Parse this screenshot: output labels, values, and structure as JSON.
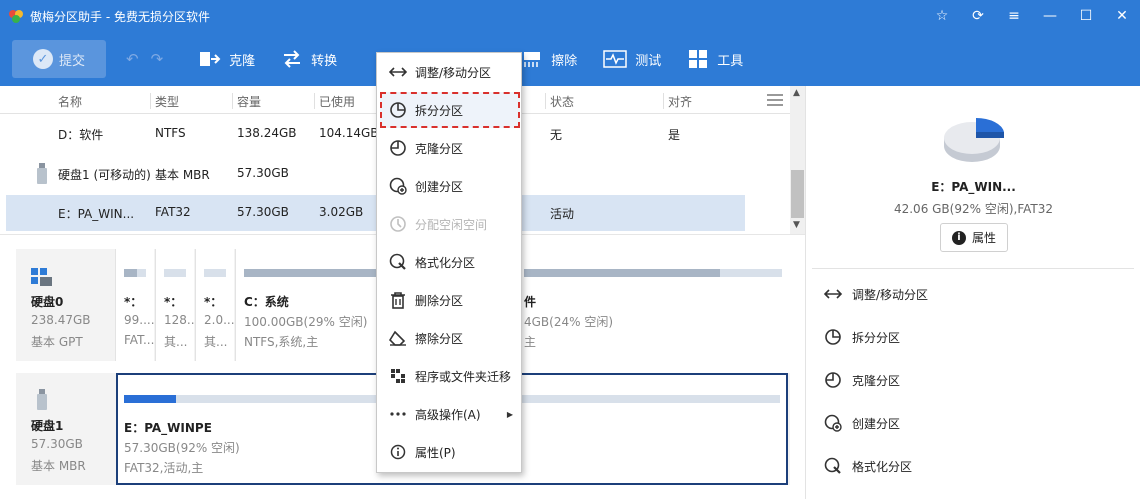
{
  "window": {
    "title": "傲梅分区助手 - 免费无损分区软件",
    "controls": [
      "star-icon",
      "refresh-icon",
      "menu-icon",
      "minimize-icon",
      "maximize-icon",
      "close-icon"
    ]
  },
  "toolbar": {
    "commit_label": "提交",
    "items": [
      {
        "label": "克隆",
        "icon": "clone-icon"
      },
      {
        "label": "转换",
        "icon": "convert-icon"
      },
      {
        "label": "擦除",
        "icon": "wipe-icon"
      },
      {
        "label": "测试",
        "icon": "test-icon"
      },
      {
        "label": "工具",
        "icon": "tools-icon"
      }
    ]
  },
  "table": {
    "headers": [
      "名称",
      "类型",
      "容量",
      "已使用",
      "",
      "状态",
      "对齐"
    ],
    "rows": [
      {
        "name": "D：软件",
        "type": "NTFS",
        "capacity": "138.24GB",
        "used": "104.14GB",
        "status": "无",
        "align": "是"
      },
      {
        "name": "硬盘1 (可移动的)",
        "type": "基本 MBR",
        "capacity": "57.30GB",
        "used": "",
        "status": "",
        "align": ""
      },
      {
        "name": "E：PA_WIN...",
        "type": "FAT32",
        "capacity": "57.30GB",
        "used": "3.02GB",
        "status": "活动",
        "align": ""
      }
    ]
  },
  "disks": [
    {
      "name": "硬盘0",
      "size": "238.47GB",
      "style": "基本 GPT",
      "partitions": [
        {
          "title": "*：",
          "line1": "99....",
          "line2": "FAT...",
          "fill_pct": 60
        },
        {
          "title": "*：",
          "line1": "128...",
          "line2": "其...",
          "fill_pct": 0
        },
        {
          "title": "*：",
          "line1": "2.0...",
          "line2": "其...",
          "fill_pct": 0
        },
        {
          "title": "C：系统",
          "line1": "100.00GB(29% 空闲)",
          "line2": "NTFS,系统,主",
          "fill_pct": 71
        },
        {
          "title": "件",
          "line1": "4GB(24% 空闲)",
          "line2": "主",
          "fill_pct": 76
        }
      ]
    },
    {
      "name": "硬盘1",
      "size": "57.30GB",
      "style": "基本 MBR",
      "partitions": [
        {
          "title": "E：PA_WINPE",
          "line1": "57.30GB(92% 空闲)",
          "line2": "FAT32,活动,主",
          "fill_pct": 8
        }
      ]
    }
  ],
  "context_menu": {
    "items": [
      {
        "label": "调整/移动分区",
        "icon": "resize-icon",
        "enabled": true
      },
      {
        "label": "拆分分区",
        "icon": "split-icon",
        "enabled": true,
        "highlighted": true
      },
      {
        "label": "克隆分区",
        "icon": "clone-partition-icon",
        "enabled": true
      },
      {
        "label": "创建分区",
        "icon": "create-partition-icon",
        "enabled": true
      },
      {
        "label": "分配空闲空间",
        "icon": "allocate-icon",
        "enabled": false
      },
      {
        "label": "格式化分区",
        "icon": "format-icon",
        "enabled": true
      },
      {
        "label": "删除分区",
        "icon": "delete-icon",
        "enabled": true
      },
      {
        "label": "擦除分区",
        "icon": "wipe-partition-icon",
        "enabled": true
      },
      {
        "label": "程序或文件夹迁移",
        "icon": "migrate-icon",
        "enabled": true
      },
      {
        "label": "高级操作(A)",
        "icon": "more-icon",
        "enabled": true,
        "submenu": true
      },
      {
        "label": "属性(P)",
        "icon": "info-icon",
        "enabled": true
      }
    ]
  },
  "right_panel": {
    "partition_name": "E：PA_WIN...",
    "partition_info": "42.06 GB(92% 空闲),FAT32",
    "properties_label": "属性",
    "actions": [
      "调整/移动分区",
      "拆分分区",
      "克隆分区",
      "创建分区",
      "格式化分区"
    ],
    "pie_used_color": "#2a6fd6",
    "pie_free_color": "#e8eaee"
  }
}
